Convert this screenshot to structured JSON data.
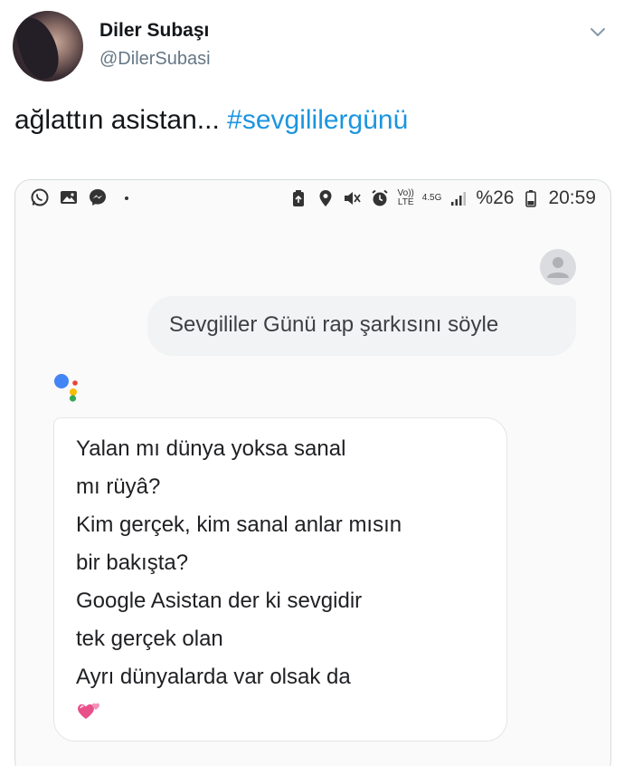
{
  "tweet": {
    "name": "Diler Subaşı",
    "handle": "@DilerSubasi",
    "text_plain": "ağlattın asistan... ",
    "hashtag": "#sevgililergünü"
  },
  "screenshot": {
    "status_bar": {
      "left_icons": [
        "whatsapp-icon",
        "gallery-icon",
        "messenger-icon",
        "dot-icon"
      ],
      "right_icons": [
        "battery-saver-icon",
        "location-icon",
        "mute-icon",
        "alarm-icon",
        "volte-icon",
        "4-5g-icon",
        "signal-icon"
      ],
      "volte_label": "Vo)) LTE",
      "network_label": "4.5G",
      "battery": "%26",
      "time": "20:59"
    },
    "user_query": "Sevgililer Günü rap şarkısını söyle",
    "assistant_reply": {
      "lines": [
        "Yalan mı dünya yoksa sanal",
        "mı rüyâ?",
        "Kim gerçek, kim sanal anlar mısın",
        "bir bakışta?",
        "Google Asistan der ki sevgidir",
        "tek gerçek olan",
        "Ayrı dünyalarda var olsak da"
      ],
      "emoji": "two-hearts-icon"
    },
    "colors": {
      "hashtag": "#1b95e0",
      "google_blue": "#4285f4",
      "google_red": "#ea4335",
      "google_yellow": "#fbbc05",
      "google_green": "#34a853",
      "heart_pink": "#e8508a"
    }
  }
}
